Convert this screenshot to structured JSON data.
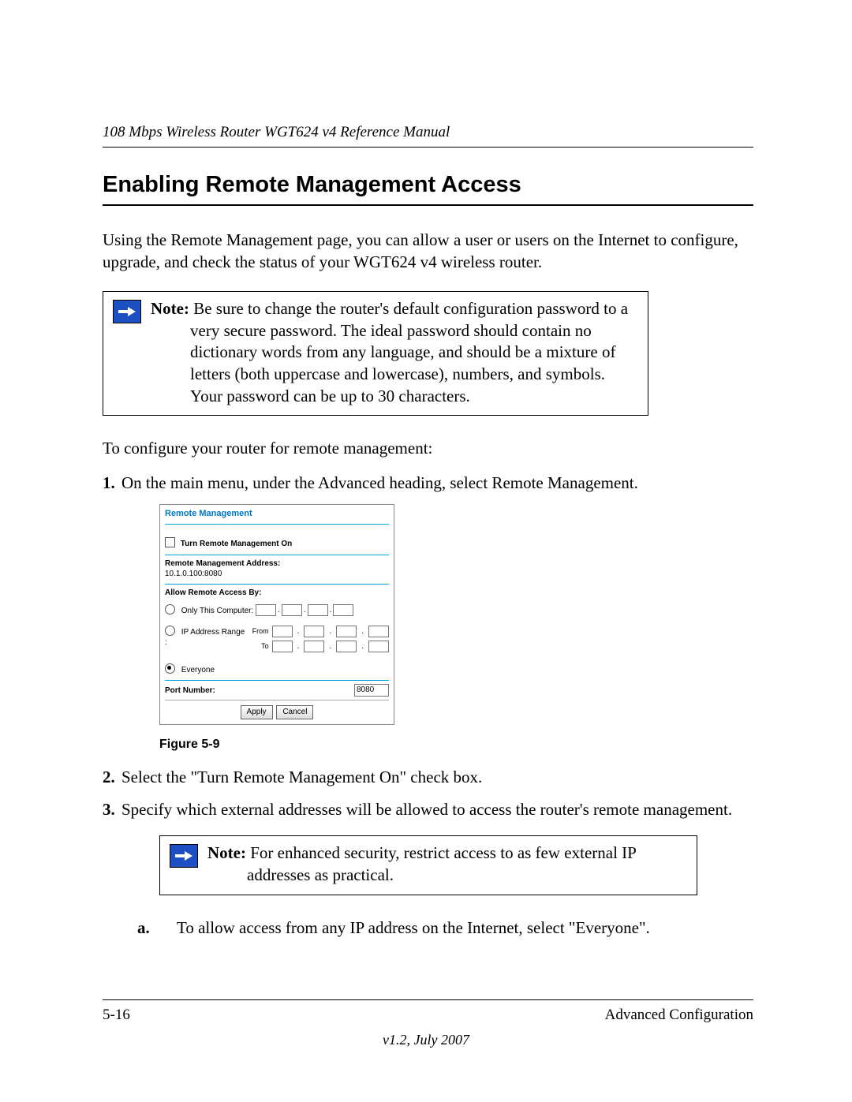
{
  "header": {
    "running_title": "108 Mbps Wireless Router WGT624 v4 Reference Manual"
  },
  "section": {
    "title": "Enabling Remote Management Access",
    "intro": "Using the Remote Management page, you can allow a user or users on the Internet to configure, upgrade, and check the status of your WGT624 v4 wireless router."
  },
  "note1": {
    "label": "Note:",
    "text": " Be sure to change the router's default configuration password to a very secure password. The ideal password should contain no dictionary words from any language, and should be a mixture of letters (both uppercase and lowercase), numbers, and symbols. Your password can be up to 30 characters."
  },
  "lead": "To configure your router for remote management:",
  "steps": [
    {
      "n": "1.",
      "t": "On the main menu, under the Advanced heading, select Remote Management."
    },
    {
      "n": "2.",
      "t": "Select the \"Turn Remote Management On\" check box."
    },
    {
      "n": "3.",
      "t": "Specify which external addresses will be allowed to access the router's remote management."
    }
  ],
  "figure": {
    "caption": "Figure 5-9",
    "panel": {
      "title": "Remote Management",
      "turn_on": "Turn Remote Management On",
      "addr_label": "Remote Management Address:",
      "addr_value": "10.1.0.100:8080",
      "allow_label": "Allow Remote Access By:",
      "opt_only": "Only This Computer:",
      "opt_range": "IP Address Range :",
      "from": "From",
      "to": "To",
      "opt_everyone": "Everyone",
      "port_label": "Port Number:",
      "port_value": "8080",
      "apply": "Apply",
      "cancel": "Cancel"
    }
  },
  "note2": {
    "label": "Note:",
    "text": "  For enhanced security, restrict access to as few external IP addresses as practical."
  },
  "substep": {
    "n": "a.",
    "t": "To allow access from any IP address on the Internet, select \"Everyone\"."
  },
  "footer": {
    "page": "5-16",
    "chapter": "Advanced Configuration",
    "version": "v1.2, July 2007"
  }
}
